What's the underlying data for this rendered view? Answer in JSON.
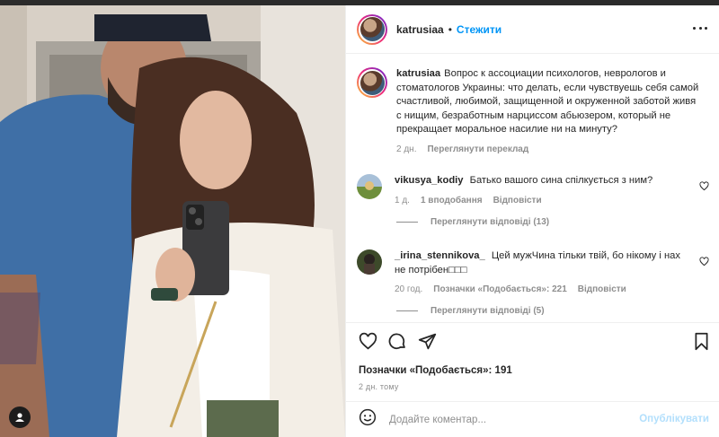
{
  "post": {
    "author": "katrusiaa",
    "separator": "•",
    "follow_label": "Стежити",
    "more_icon": "more-horizontal-icon"
  },
  "caption": {
    "username": "katrusiaa",
    "text": "Вопрос к ассоциации психологов, неврологов и стоматологов Украины: что делать, если чувствуешь себя самой счастливой, любимой, защищенной и окруженной заботой живя с нищим, безработным нарциссом абьюзером, который не прекращает моральное насилие ни на минуту?",
    "age": "2 дн.",
    "translate_label": "Переглянути переклад"
  },
  "comments": [
    {
      "username": "vikusya_kodiy",
      "text": "Батько вашого сина спілкується з ним?",
      "age": "1 д.",
      "likes": "1 вподобання",
      "reply_label": "Відповісти",
      "view_replies": "Переглянути відповіді (13)"
    },
    {
      "username": "_irina_stennikova_",
      "text": "Цей мужЧина тільки твій, бо нікому і нах не потрібен□□□",
      "age": "20 год.",
      "likes": "Позначки «Подобається»: 221",
      "reply_label": "Відповісти",
      "view_replies": "Переглянути відповіді (5)"
    }
  ],
  "actions": {
    "likes_label": "Позначки «Подобається»: 191",
    "time_label": "2 дн. тому"
  },
  "composer": {
    "placeholder": "Додайте коментар...",
    "publish_label": "Опублікувати"
  },
  "colors": {
    "accent": "#0095f6",
    "publish_disabled": "#b2dffc",
    "muted": "#8e8e8e",
    "text": "#262626"
  }
}
